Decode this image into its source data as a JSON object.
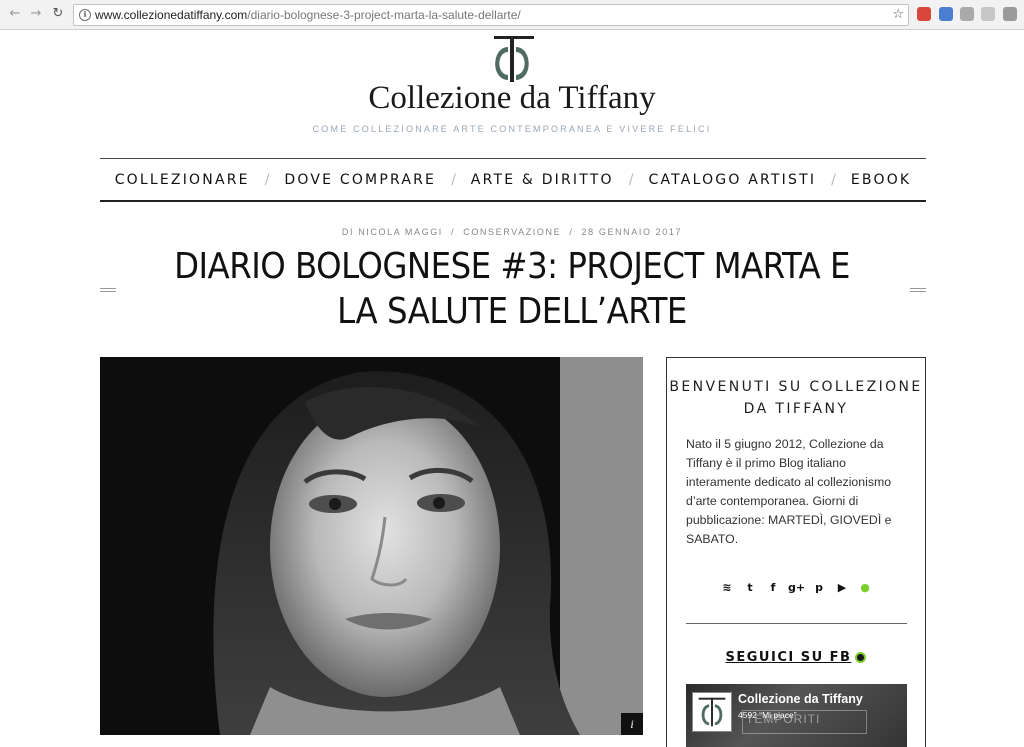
{
  "browser": {
    "url_host": "www.collezionedatiffany.com",
    "url_path": "/diario-bolognese-3-project-marta-la-salute-dellarte/",
    "back_icon": "←",
    "forward_icon": "→",
    "reload_icon": "↻",
    "star_icon": "☆",
    "info_icon": "i",
    "extension_colors": [
      "#d9473b",
      "#4a7fcf",
      "#aaaaaa",
      "#c6c6c6",
      "#9a9a9a"
    ]
  },
  "header": {
    "site_title": "Collezione da Tiffany",
    "tagline": "COME COLLEZIONARE ARTE CONTEMPORANEA E VIVERE FELICI",
    "logo_colors": [
      "#222222",
      "#4f6b63"
    ]
  },
  "nav": {
    "items": [
      "COLLEZIONARE",
      "DOVE COMPRARE",
      "ARTE & DIRITTO",
      "CATALOGO ARTISTI",
      "EBOOK"
    ],
    "separator": "/"
  },
  "post": {
    "author": "DI NICOLA MAGGI",
    "sep1": "/",
    "category": "CONSERVAZIONE",
    "sep2": "/",
    "date": "28 GENNAIO 2017",
    "title": "DIARIO BOLOGNESE #3: PROJECT MARTA E LA SALUTE DELL’ARTE",
    "image_badge": "i"
  },
  "sidebar": {
    "welcome_title": "BENVENUTI SU COLLEZIONE DA TIFFANY",
    "welcome_text": "Nato il 5 giugno 2012, Collezione da Tiffany è il primo Blog italiano interamente dedicato al collezionismo d’arte contemporanea. Giorni di pubblicazione: MARTEDÌ, GIOVEDÌ e SABATO.",
    "social": [
      {
        "name": "rss-icon",
        "glyph": "≋"
      },
      {
        "name": "twitter-icon",
        "glyph": "t"
      },
      {
        "name": "facebook-icon",
        "glyph": "f"
      },
      {
        "name": "google-plus-icon",
        "glyph": "g+"
      },
      {
        "name": "pinterest-icon",
        "glyph": "p"
      },
      {
        "name": "youtube-icon",
        "glyph": "▶"
      },
      {
        "name": "more-icon",
        "glyph": "●"
      }
    ],
    "accent_color": "#7bd030",
    "fb_title": "SEGUICI SU FB",
    "fb_page_name": "Collezione da Tiffany",
    "fb_likes": "4592 “Mi piace”",
    "fb_bg_text": "TEMPORITI"
  }
}
